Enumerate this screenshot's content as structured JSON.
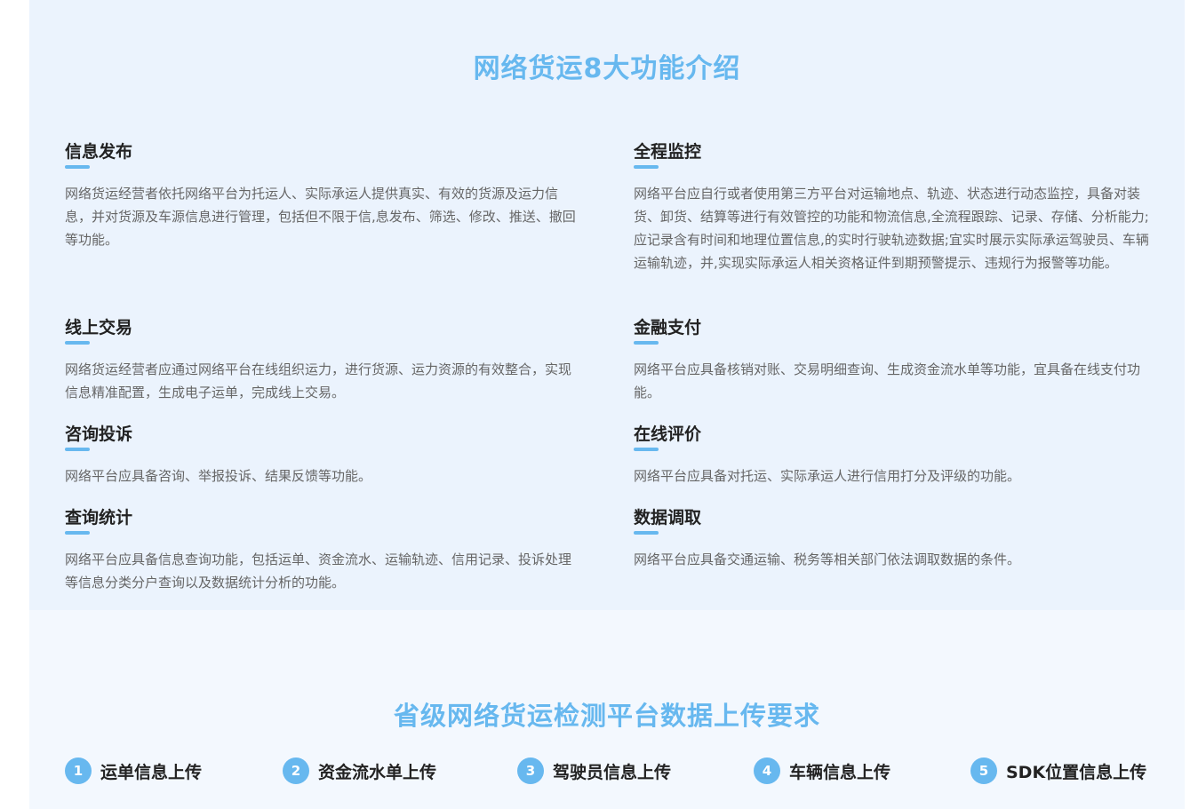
{
  "title": "网络货运8大功能介绍",
  "features": [
    {
      "title": "信息发布",
      "desc": "网络货运经营者依托网络平台为托运人、实际承运人提供真实、有效的货源及运力信息，并对货源及车源信息进行管理，包括但不限于信,息发布、筛选、修改、推送、撤回等功能。"
    },
    {
      "title": "全程监控",
      "desc": "网络平台应自行或者使用第三方平台对运输地点、轨迹、状态进行动态监控，具备对装货、卸货、结算等进行有效管控的功能和物流信息,全流程跟踪、记录、存储、分析能力;应记录含有时间和地理位置信息,的实时行驶轨迹数据;宜实时展示实际承运驾驶员、车辆运输轨迹，并,实现实际承运人相关资格证件到期预警提示、违规行为报警等功能。"
    },
    {
      "title": "线上交易",
      "desc": "网络货运经营者应通过网络平台在线组织运力，进行货源、运力资源的有效整合，实现信息精准配置，生成电子运单，完成线上交易。"
    },
    {
      "title": "金融支付",
      "desc": "网络平台应具备核销对账、交易明细查询、生成资金流水单等功能，宜具备在线支付功能。"
    },
    {
      "title": "咨询投诉",
      "desc": "网络平台应具备咨询、举报投诉、结果反馈等功能。"
    },
    {
      "title": "在线评价",
      "desc": "网络平台应具备对托运、实际承运人进行信用打分及评级的功能。"
    },
    {
      "title": "查询统计",
      "desc": "网络平台应具备信息查询功能，包括运单、资金流水、运输轨迹、信用记录、投诉处理等信息分类分户查询以及数据统计分析的功能。"
    },
    {
      "title": "数据调取",
      "desc": "网络平台应具备交通运输、税务等相关部门依法调取数据的条件。"
    }
  ],
  "requirements_title": "省级网络货运检测平台数据上传要求",
  "requirements": [
    {
      "num": "1",
      "label": "运单信息上传"
    },
    {
      "num": "2",
      "label": "资金流水单上传"
    },
    {
      "num": "3",
      "label": "驾驶员信息上传"
    },
    {
      "num": "4",
      "label": "车辆信息上传"
    },
    {
      "num": "5",
      "label": "SDK位置信息上传"
    }
  ],
  "colors": {
    "accent": "#67b8ef",
    "section_bg_top": "#ebf3fd",
    "section_bg_bottom": "#f3f8fe",
    "heading": "#222222",
    "body_text": "#666666"
  }
}
